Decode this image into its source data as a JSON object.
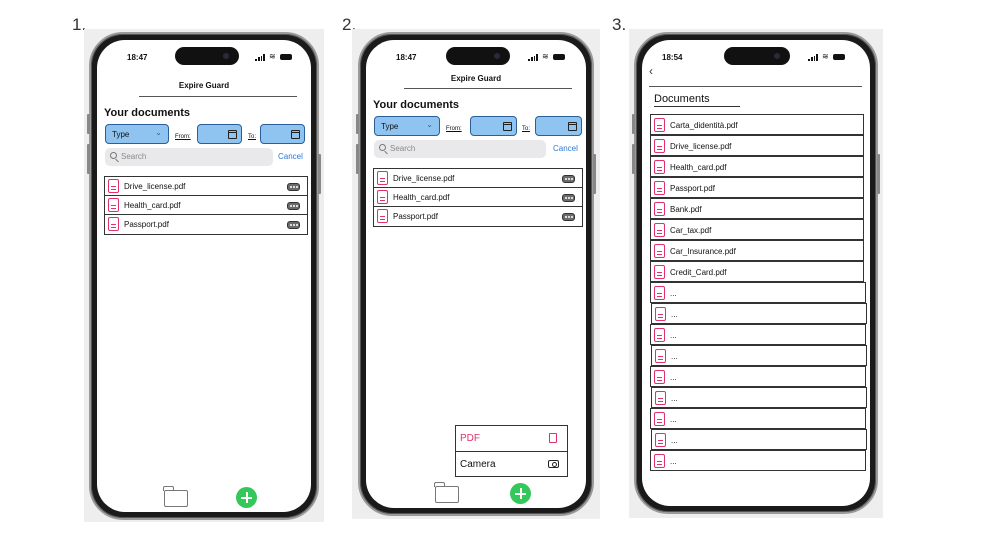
{
  "steps": [
    "1.",
    "2.",
    "3."
  ],
  "status_bar": {
    "screen1_time": "18:47",
    "screen2_time": "18:47",
    "screen3_time": "18:54"
  },
  "app": {
    "title": "Expire Guard"
  },
  "filters": {
    "heading": "Your documents",
    "type_label": "Type",
    "from_label": "From:",
    "to_label": "To:",
    "search_placeholder": "Search",
    "cancel_label": "Cancel"
  },
  "documents": [
    "Drive_license.pdf",
    "Health_card.pdf",
    "Passport.pdf"
  ],
  "add_menu": {
    "pdf_label": "PDF",
    "camera_label": "Camera"
  },
  "screen3": {
    "heading": "Documents",
    "files": [
      "Carta_didentità.pdf",
      "Drive_license.pdf",
      "Health_card.pdf",
      "Passport.pdf",
      "Bank.pdf",
      "Car_tax.pdf",
      "Car_Insurance.pdf",
      "Credit_Card.pdf",
      "...",
      "...",
      "...",
      "...",
      "...",
      "...",
      "...",
      "...",
      "..."
    ]
  },
  "icons": {
    "accent_pink": "#e0306e",
    "field_blue": "#8fc3f0",
    "add_green": "#34c759",
    "link_blue": "#2b78d6"
  }
}
